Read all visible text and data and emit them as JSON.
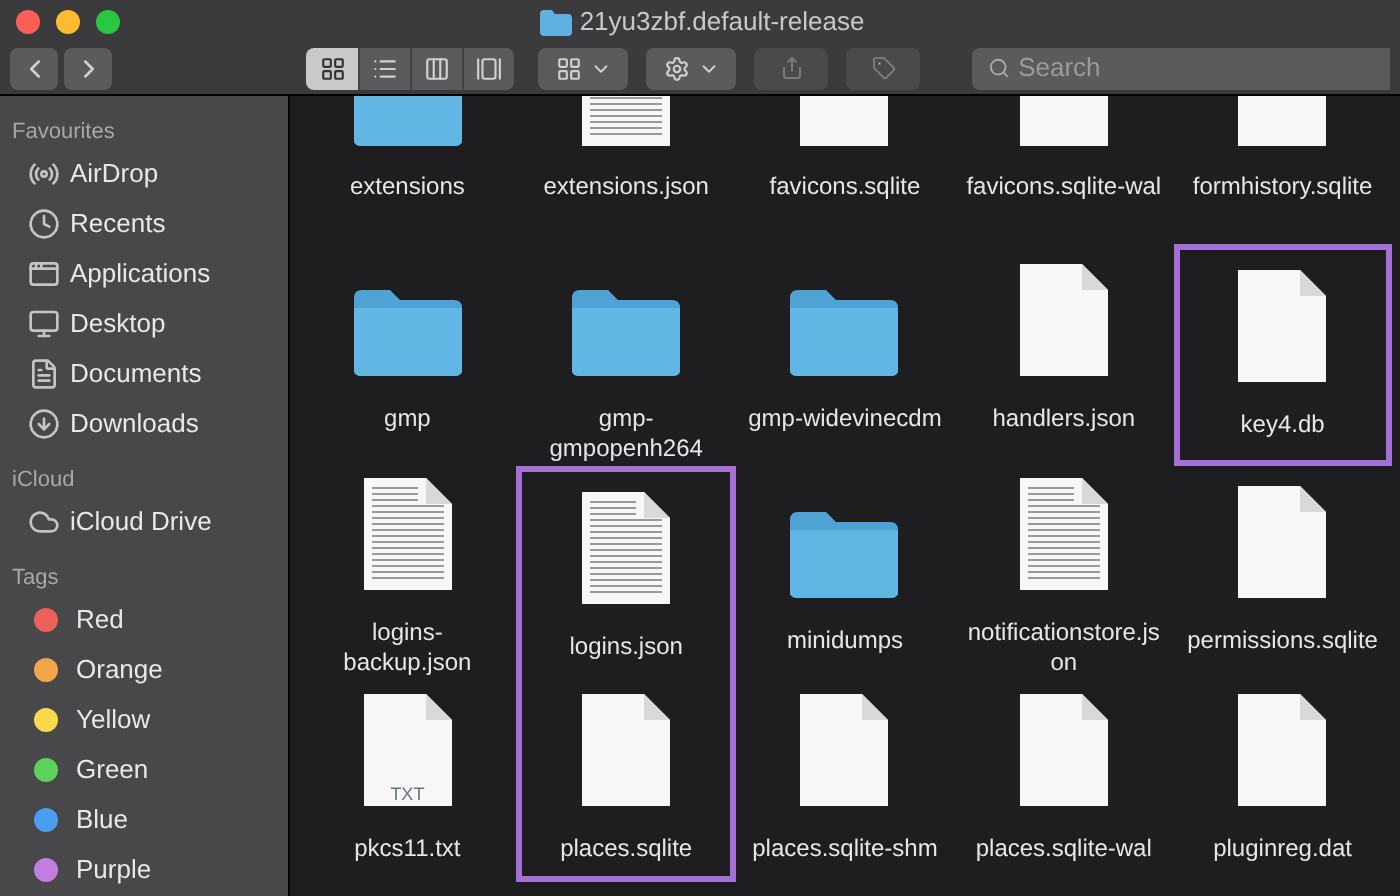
{
  "window": {
    "title": "21yu3zbf.default-release"
  },
  "toolbar": {
    "view_modes": [
      {
        "selected": true
      },
      {
        "selected": false
      },
      {
        "selected": false
      },
      {
        "selected": false
      }
    ],
    "search": {
      "placeholder": "Search"
    }
  },
  "sidebar": {
    "sections": [
      {
        "title": "Favourites",
        "items": [
          {
            "label": "AirDrop"
          },
          {
            "label": "Recents"
          },
          {
            "label": "Applications"
          },
          {
            "label": "Desktop"
          },
          {
            "label": "Documents"
          },
          {
            "label": "Downloads"
          }
        ]
      },
      {
        "title": "iCloud",
        "items": [
          {
            "label": "iCloud Drive"
          }
        ]
      },
      {
        "title": "Tags",
        "tags": [
          {
            "label": "Red",
            "color": "#ec5f5a"
          },
          {
            "label": "Orange",
            "color": "#f4a54a"
          },
          {
            "label": "Yellow",
            "color": "#f7d94b"
          },
          {
            "label": "Green",
            "color": "#5bd35b"
          },
          {
            "label": "Blue",
            "color": "#4b9df0"
          },
          {
            "label": "Purple",
            "color": "#c27de0"
          }
        ]
      }
    ]
  },
  "files": [
    {
      "name": "extensions",
      "kind": "folder",
      "highlighted": false
    },
    {
      "name": "extensions.json",
      "kind": "text",
      "highlighted": false
    },
    {
      "name": "favicons.sqlite",
      "kind": "blank",
      "highlighted": false
    },
    {
      "name": "favicons.sqlite-wal",
      "kind": "blank",
      "highlighted": false
    },
    {
      "name": "formhistory.sqlite",
      "kind": "blank",
      "highlighted": false
    },
    {
      "name": "gmp",
      "kind": "folder",
      "highlighted": false
    },
    {
      "name": "gmp-gmpopenh264",
      "kind": "folder",
      "highlighted": false
    },
    {
      "name": "gmp-widevinecdm",
      "kind": "folder",
      "highlighted": false
    },
    {
      "name": "handlers.json",
      "kind": "blank",
      "highlighted": false
    },
    {
      "name": "key4.db",
      "kind": "blank",
      "highlighted": true
    },
    {
      "name": "logins-backup.json",
      "kind": "text",
      "highlighted": false
    },
    {
      "name": "logins.json",
      "kind": "text",
      "highlighted": true
    },
    {
      "name": "minidumps",
      "kind": "folder",
      "highlighted": false
    },
    {
      "name": "notificationstore.json",
      "kind": "text",
      "highlighted": false
    },
    {
      "name": "permissions.sqlite",
      "kind": "blank",
      "highlighted": false
    },
    {
      "name": "pkcs11.txt",
      "kind": "txt",
      "badge": "TXT",
      "highlighted": false
    },
    {
      "name": "places.sqlite",
      "kind": "blank",
      "highlighted": true
    },
    {
      "name": "places.sqlite-shm",
      "kind": "blank",
      "highlighted": false
    },
    {
      "name": "places.sqlite-wal",
      "kind": "blank",
      "highlighted": false
    },
    {
      "name": "pluginreg.dat",
      "kind": "blank",
      "highlighted": false
    }
  ]
}
